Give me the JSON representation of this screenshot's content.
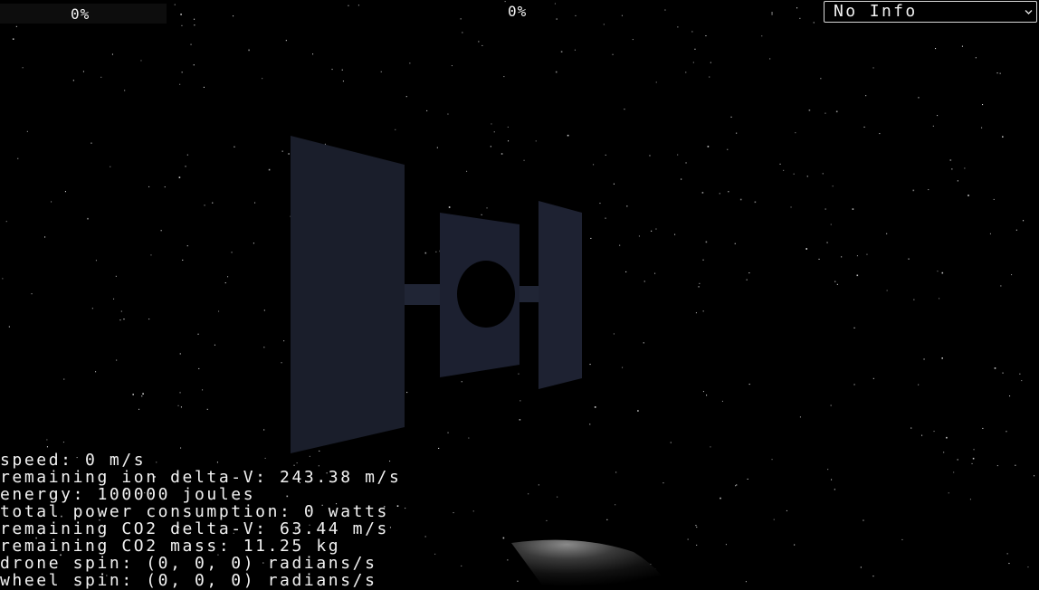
{
  "hud": {
    "progress_left_label": "0%",
    "progress_center_label": "0%",
    "info_select": {
      "selected": "No Info"
    }
  },
  "stats": {
    "speed": "speed: 0 m/s",
    "ion_delta_v": "remaining ion delta-V: 243.38 m/s",
    "energy": "energy: 100000 joules",
    "power": "total power consumption: 0 watts",
    "co2_delta_v": "remaining CO2 delta-V: 63.44 m/s",
    "co2_mass": "remaining CO2 mass: 11.25 kg",
    "drone_spin": "drone spin: (0, 0, 0) radians/s",
    "wheel_spin": "wheel spin: (0, 0, 0) radians/s"
  },
  "icons": {
    "info_select_chevron": "chevron-down-icon"
  },
  "colors": {
    "background": "#000000",
    "hud_text": "#f2f2f2",
    "structure": "#1a1e2c",
    "planet": "#6a6a6a"
  }
}
